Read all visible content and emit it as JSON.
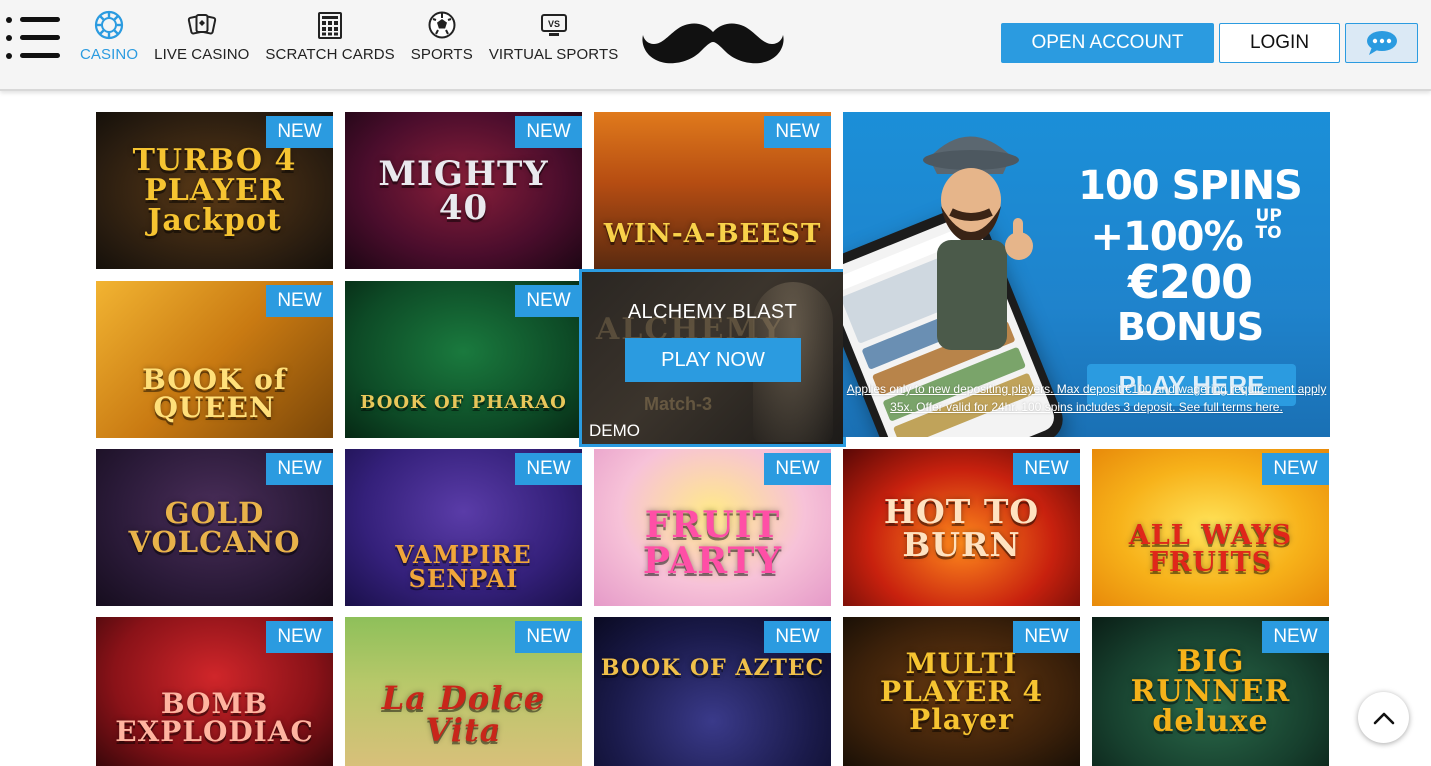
{
  "header": {
    "nav": [
      {
        "label": "CASINO",
        "icon": "casino-chip-icon",
        "active": true
      },
      {
        "label": "LIVE CASINO",
        "icon": "live-casino-cards-icon",
        "active": false
      },
      {
        "label": "SCRATCH CARDS",
        "icon": "scratch-card-icon",
        "active": false
      },
      {
        "label": "SPORTS",
        "icon": "soccer-ball-icon",
        "active": false
      },
      {
        "label": "VIRTUAL SPORTS",
        "icon": "virtual-sports-icon",
        "active": false
      }
    ],
    "logo": "mustache-logo",
    "open_account_label": "OPEN ACCOUNT",
    "login_label": "LOGIN",
    "chat_icon": "chat-bubble-icon"
  },
  "games": [
    {
      "title": "TURBO 4 PLAYER Jackpot",
      "badge": "NEW"
    },
    {
      "title": "MIGHTY 40",
      "badge": "NEW"
    },
    {
      "title": "WIN-A-BEEST",
      "badge": "NEW"
    },
    {
      "title": "BOOK of QUEEN",
      "badge": "NEW"
    },
    {
      "title": "BOOK OF PHARAO",
      "badge": "NEW"
    },
    {
      "title": "GOLD VOLCANO",
      "badge": "NEW"
    },
    {
      "title": "VAMPIRE SENPAI",
      "badge": "NEW"
    },
    {
      "title": "FRUIT PARTY",
      "badge": "NEW"
    },
    {
      "title": "HOT TO BURN",
      "badge": "NEW"
    },
    {
      "title": "ALL WAYS FRUITS",
      "badge": "NEW"
    },
    {
      "title": "BOMB EXPLODIAC",
      "badge": "NEW"
    },
    {
      "title": "La Dolce Vita",
      "badge": "NEW"
    },
    {
      "title": "BOOK OF AZTEC",
      "badge": "NEW"
    },
    {
      "title": "MULTI PLAYER 4 Player",
      "badge": "NEW"
    },
    {
      "title": "BIG RUNNER deluxe",
      "badge": "NEW"
    }
  ],
  "hovered_game": {
    "title": "ALCHEMY BLAST",
    "play_label": "PLAY NOW",
    "demo_label": "DEMO"
  },
  "promo": {
    "line1": "100 SPINS",
    "line2": "+100%",
    "line2_small": "UP TO",
    "line3": "€200",
    "line4": "BONUS",
    "cta_label": "PLAY HERE",
    "terms": "Applies only to new depositing players. Max deposit €100 and wagering requirement apply 35x. Offer valid for 24hr. 100 spins includes 3 deposit. See full terms here."
  },
  "scroll_top_icon": "chevron-up-icon"
}
